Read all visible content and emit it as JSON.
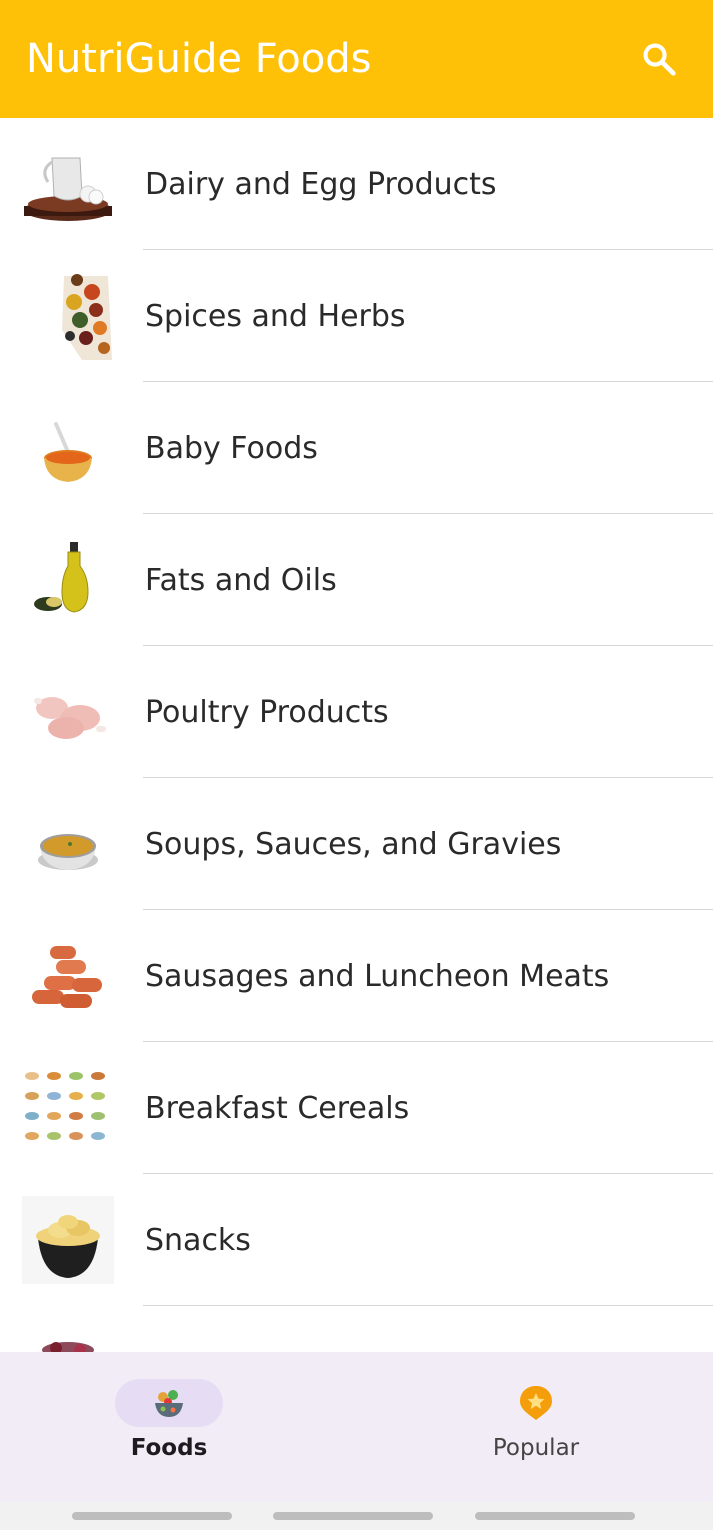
{
  "app_bar": {
    "title": "NutriGuide Foods",
    "background": "#FFC107",
    "search_icon": "search-icon"
  },
  "categories": [
    {
      "label": "Dairy and Egg Products",
      "icon": "dairy-egg-image"
    },
    {
      "label": "Spices and Herbs",
      "icon": "spices-herbs-image"
    },
    {
      "label": "Baby Foods",
      "icon": "baby-food-image"
    },
    {
      "label": "Fats and Oils",
      "icon": "oil-bottle-image"
    },
    {
      "label": "Poultry Products",
      "icon": "chicken-drumstick-image"
    },
    {
      "label": "Soups, Sauces, and Gravies",
      "icon": "soup-bowl-image"
    },
    {
      "label": "Sausages and Luncheon Meats",
      "icon": "sausages-image"
    },
    {
      "label": "Breakfast Cereals",
      "icon": "breakfast-grid-image"
    },
    {
      "label": "Snacks",
      "icon": "chips-bowl-image"
    }
  ],
  "bottom_nav": {
    "items": [
      {
        "label": "Foods",
        "icon": "salad-bowl-icon",
        "selected": true
      },
      {
        "label": "Popular",
        "icon": "star-badge-icon",
        "selected": false
      }
    ]
  },
  "colors": {
    "accent": "#FFC107",
    "nav_background": "#F2ECF7",
    "nav_pill": "#E6DDF5",
    "divider": "#D6D6D6"
  }
}
